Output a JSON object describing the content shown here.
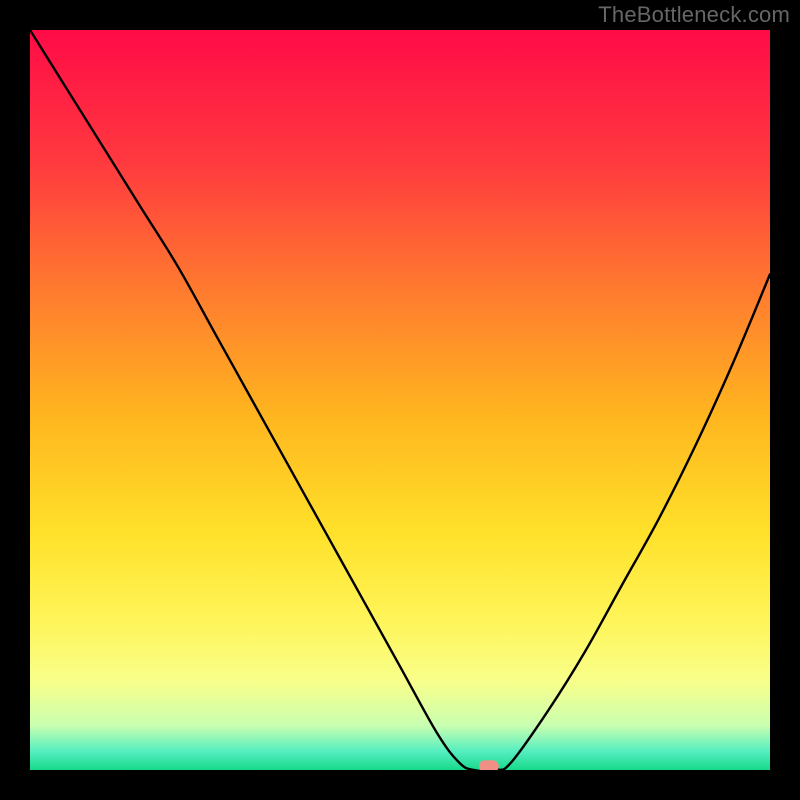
{
  "watermark": "TheBottleneck.com",
  "chart_data": {
    "type": "line",
    "title": "",
    "xlabel": "",
    "ylabel": "",
    "xlim": [
      0,
      100
    ],
    "ylim": [
      0,
      100
    ],
    "x": [
      0,
      5,
      10,
      15,
      20,
      25,
      30,
      35,
      40,
      45,
      50,
      55,
      58,
      60,
      63,
      65,
      70,
      75,
      80,
      85,
      90,
      95,
      100
    ],
    "values": [
      100,
      92,
      84,
      76,
      68,
      59,
      50,
      41,
      32,
      23,
      14,
      5,
      1,
      0,
      0,
      1,
      8,
      16,
      25,
      34,
      44,
      55,
      67
    ],
    "marker": {
      "x": 62,
      "y": 0.5
    },
    "gradient_stops": [
      {
        "offset": 0.0,
        "color": "#ff0b47"
      },
      {
        "offset": 0.18,
        "color": "#ff3a3f"
      },
      {
        "offset": 0.35,
        "color": "#ff7a2f"
      },
      {
        "offset": 0.52,
        "color": "#ffb51f"
      },
      {
        "offset": 0.68,
        "color": "#ffe12a"
      },
      {
        "offset": 0.8,
        "color": "#fff55a"
      },
      {
        "offset": 0.88,
        "color": "#f8ff8a"
      },
      {
        "offset": 0.94,
        "color": "#c9ffb0"
      },
      {
        "offset": 0.975,
        "color": "#55eec0"
      },
      {
        "offset": 1.0,
        "color": "#16d98a"
      }
    ]
  }
}
